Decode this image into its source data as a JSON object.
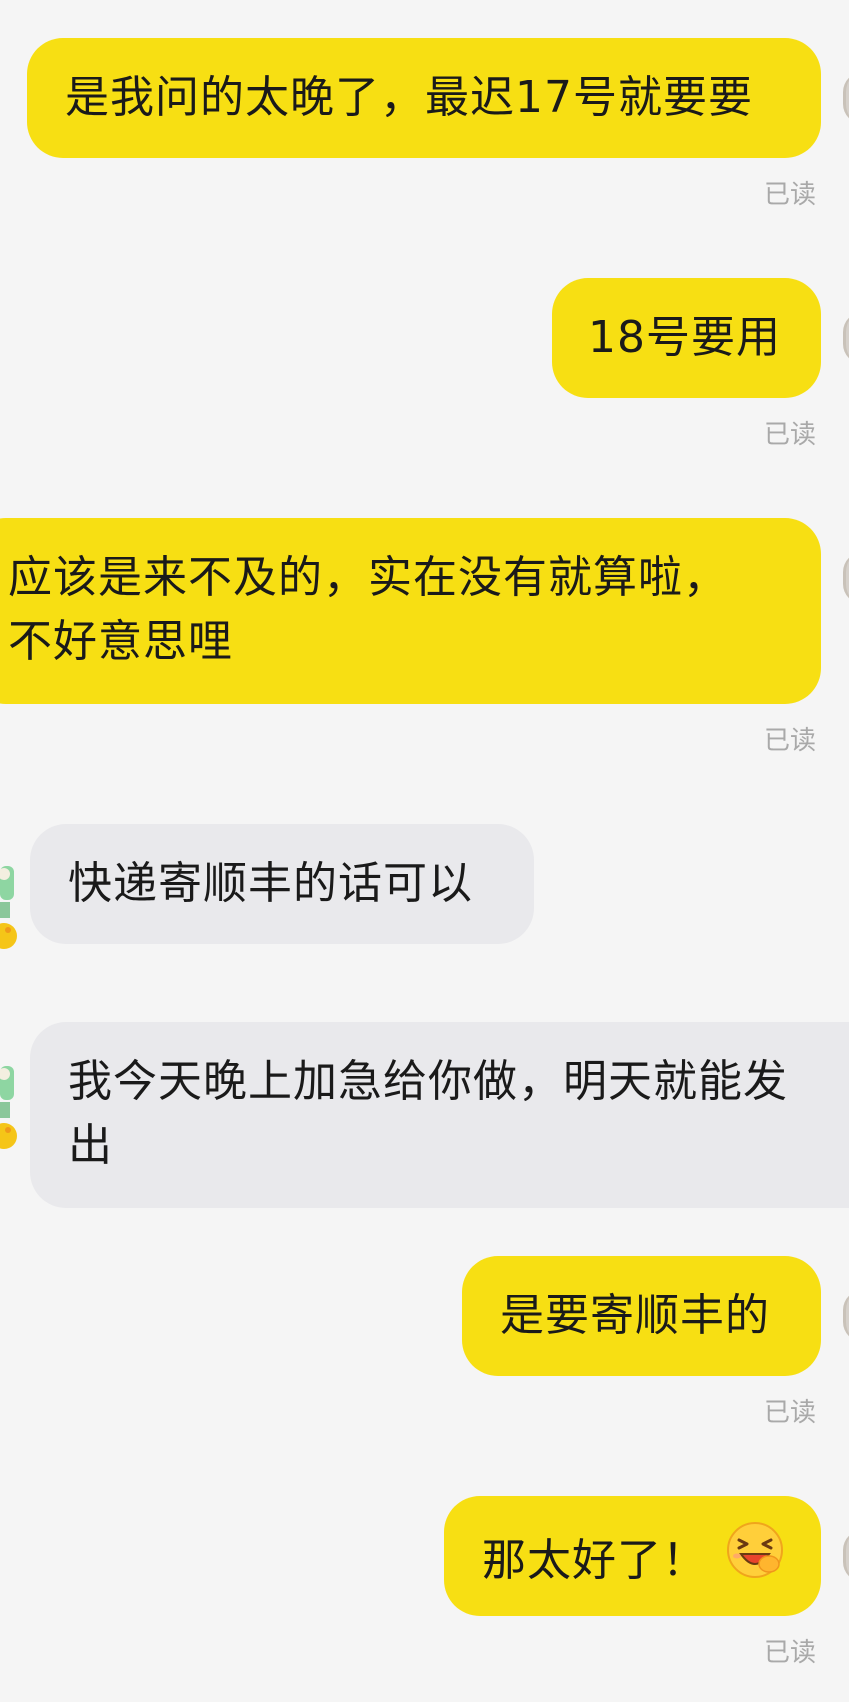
{
  "messages": [
    {
      "id": 1,
      "text": "是我问的太晚了，最迟17号就要要",
      "status": "已读"
    },
    {
      "id": 2,
      "text": "18号要用",
      "status": "已读"
    },
    {
      "id": 3,
      "line1": "应该是来不及的，实在没有就算啦，",
      "line2": "不好意思哩",
      "status": "已读"
    },
    {
      "id": 4,
      "text": "快递寄顺丰的话可以"
    },
    {
      "id": 5,
      "line1": "我今天晚上加急给你做，明天就能发",
      "line2": "出"
    },
    {
      "id": 6,
      "text": "是要寄顺丰的",
      "status": "已读"
    },
    {
      "id": 7,
      "text": "那太好了！",
      "emoji": "grinning-squint-face-icon",
      "status": "已读"
    }
  ],
  "colors": {
    "outgoing_bubble": "#f7df13",
    "incoming_bubble": "#e9e9ec",
    "background": "#f5f5f5",
    "status_text": "#a9a9a9"
  }
}
